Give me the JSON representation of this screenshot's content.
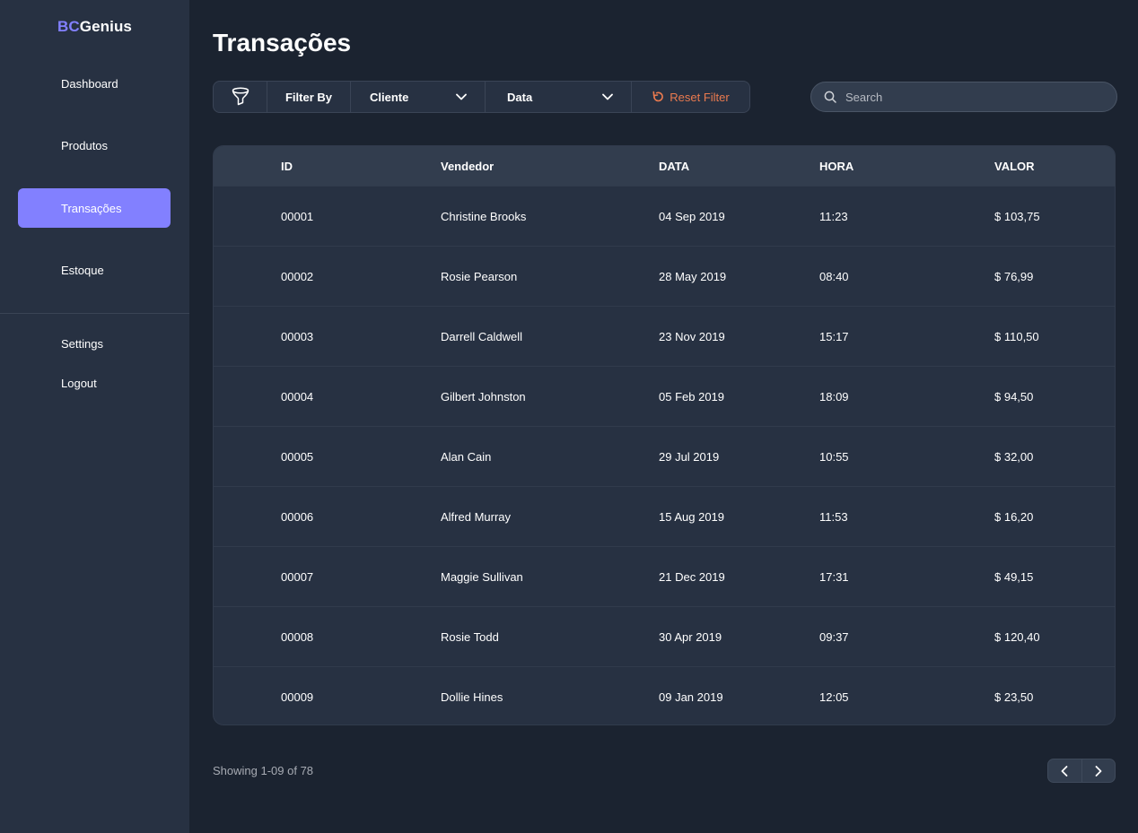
{
  "app": {
    "logo_accent": "BC",
    "logo_rest": "Genius",
    "accent_color": "#8280ff"
  },
  "sidebar": {
    "items": [
      {
        "label": "Dashboard"
      },
      {
        "label": "Produtos"
      },
      {
        "label": "Transações",
        "active": true
      },
      {
        "label": "Estoque"
      }
    ],
    "bottom_items": [
      {
        "label": "Settings"
      },
      {
        "label": "Logout"
      }
    ]
  },
  "main": {
    "title": "Transações",
    "filter": {
      "icon": "funnel-icon",
      "label": "Filter By",
      "cliente_value": "Cliente",
      "data_value": "Data",
      "reset_label": "Reset Filter",
      "reset_color": "#ea7a4f"
    },
    "search": {
      "placeholder": "Search"
    },
    "table": {
      "headers": [
        "ID",
        "Vendedor",
        "DATA",
        "HORA",
        "VALOR"
      ],
      "rows": [
        [
          "00001",
          "Christine Brooks",
          "04 Sep 2019",
          "11:23",
          "$ 103,75"
        ],
        [
          "00002",
          "Rosie Pearson",
          "28 May 2019",
          "08:40",
          "$ 76,99"
        ],
        [
          "00003",
          "Darrell Caldwell",
          "23 Nov 2019",
          "15:17",
          "$ 110,50"
        ],
        [
          "00004",
          "Gilbert Johnston",
          "05 Feb 2019",
          "18:09",
          "$ 94,50"
        ],
        [
          "00005",
          "Alan Cain",
          "29 Jul 2019",
          "10:55",
          "$ 32,00"
        ],
        [
          "00006",
          "Alfred Murray",
          "15 Aug 2019",
          "11:53",
          "$ 16,20"
        ],
        [
          "00007",
          "Maggie Sullivan",
          "21 Dec 2019",
          "17:31",
          "$ 49,15"
        ],
        [
          "00008",
          "Rosie Todd",
          "30 Apr 2019",
          "09:37",
          "$ 120,40"
        ],
        [
          "00009",
          "Dollie Hines",
          "09 Jan 2019",
          "12:05",
          "$ 23,50"
        ]
      ]
    },
    "footer": {
      "showing": "Showing 1-09 of 78"
    }
  }
}
